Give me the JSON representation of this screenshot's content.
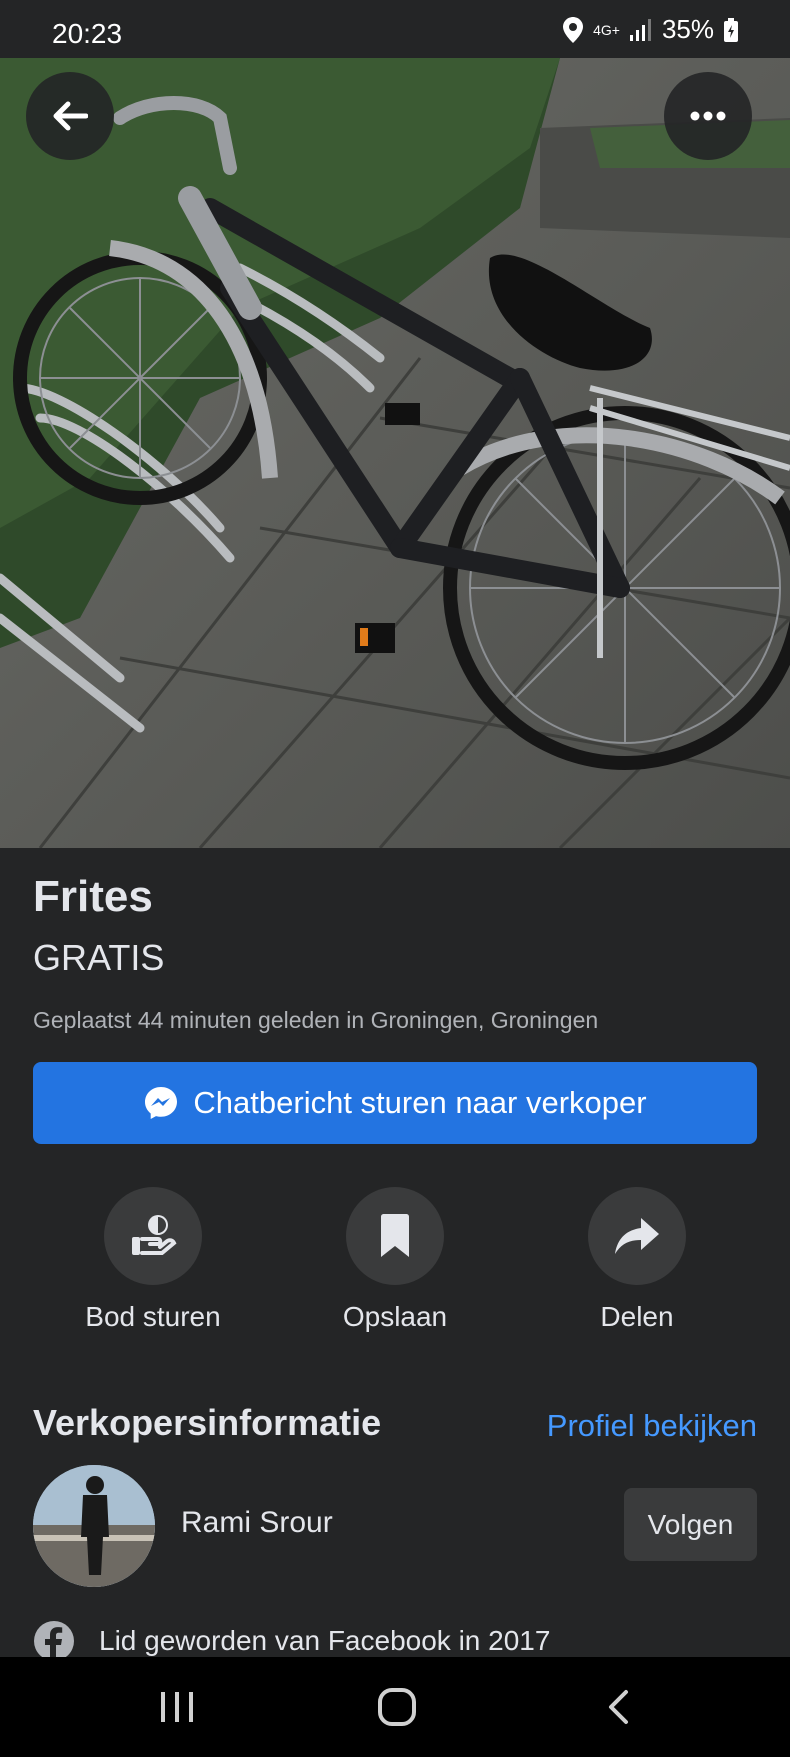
{
  "status": {
    "time": "20:23",
    "network": "4G+",
    "battery": "35%"
  },
  "header": {
    "back_icon": "arrow-left-icon",
    "more_icon": "more-horizontal-icon"
  },
  "listing": {
    "title": "Frites",
    "price": "GRATIS",
    "posted": "Geplaatst 44 minuten geleden in Groningen, Groningen",
    "message_button": "Chatbericht sturen naar verkoper"
  },
  "actions": [
    {
      "label": "Bod sturen",
      "icon": "offer-hand-icon"
    },
    {
      "label": "Opslaan",
      "icon": "bookmark-icon"
    },
    {
      "label": "Delen",
      "icon": "share-arrow-icon"
    }
  ],
  "seller": {
    "heading": "Verkopersinformatie",
    "profile_link": "Profiel bekijken",
    "name": "Rami Srour",
    "follow_button": "Volgen",
    "member_since": "Lid geworden van Facebook in 2017"
  },
  "colors": {
    "background": "#242526",
    "accent": "#2374e1",
    "link": "#4599ff"
  }
}
